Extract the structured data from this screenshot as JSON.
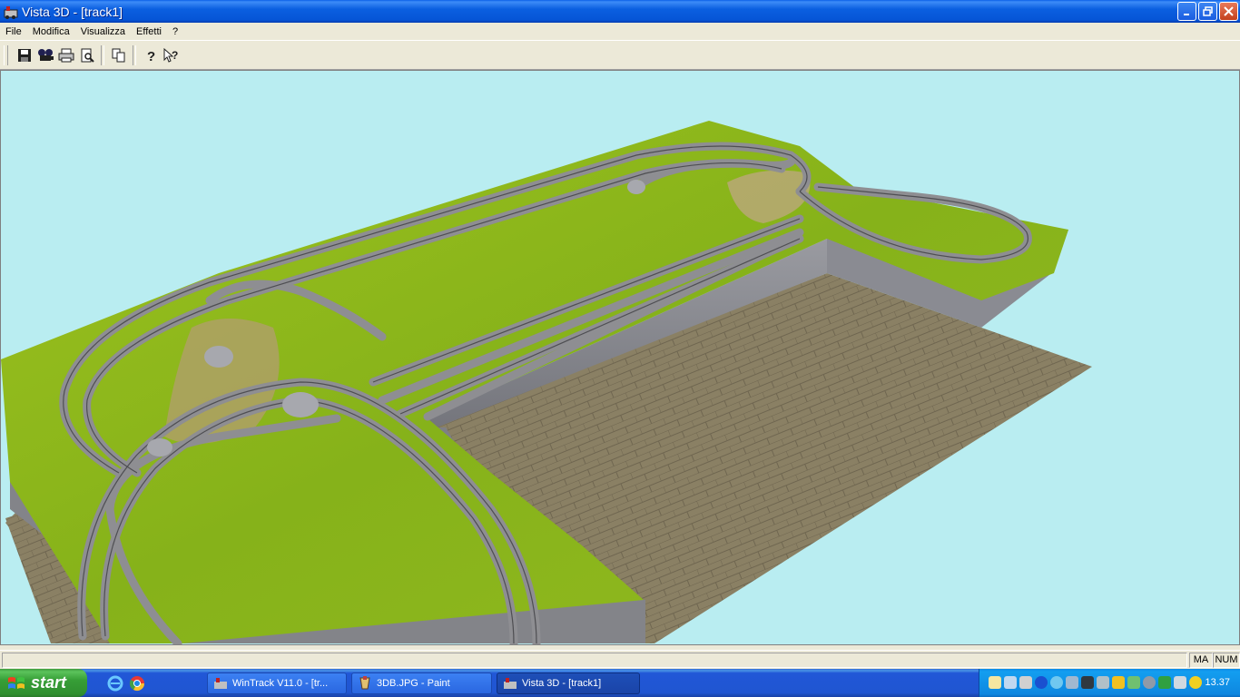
{
  "window": {
    "title": "Vista 3D - [track1]",
    "app_icon": "wintrack-app-icon"
  },
  "menu": {
    "items": [
      "File",
      "Modifica",
      "Visualizza",
      "Effetti",
      "?"
    ]
  },
  "toolbar": {
    "buttons": [
      "save-icon",
      "camera-film-icon",
      "print-icon",
      "print-preview-icon",
      "copy-icon",
      "help-icon",
      "context-help-icon"
    ]
  },
  "viewport": {
    "scene": "3d-layout-render",
    "sky_color": "#b9edf1",
    "grass_color": "#8ab81e",
    "floor_color": "#8a8064",
    "wall_color": "#8f9096"
  },
  "statusbar": {
    "caps": "MA",
    "num": "NUM"
  },
  "taskbar": {
    "start_label": "start",
    "tasks": [
      {
        "label": "WinTrack  V11.0 - [tr...",
        "active": false
      },
      {
        "label": "3DB.JPG - Paint",
        "active": false
      },
      {
        "label": "Vista 3D - [track1]",
        "active": true
      }
    ],
    "clock": "13.37"
  }
}
